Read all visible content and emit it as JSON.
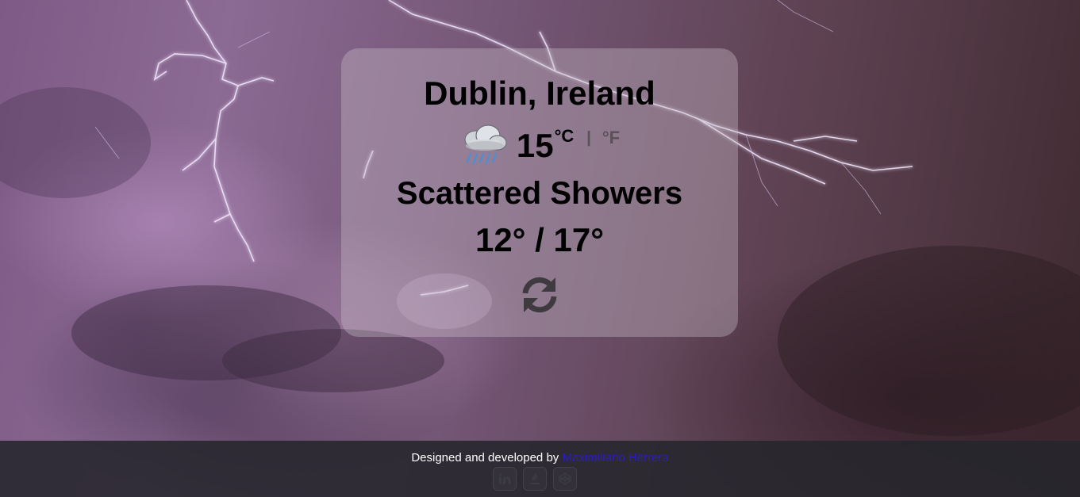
{
  "location": {
    "city": "Dublin, Ireland"
  },
  "current": {
    "temperature": "15",
    "icon": "rain-cloud-icon",
    "unit_celsius": "°C",
    "unit_separator": "|",
    "unit_fahrenheit": "°F",
    "description": "Scattered Showers",
    "range": "12° / 17°"
  },
  "actions": {
    "refresh_icon": "refresh-icon"
  },
  "footer": {
    "text": "Designed and developed by ",
    "author": "Maximiliano Herrera",
    "social": [
      "linkedin-icon",
      "freecodecamp-icon",
      "codepen-icon"
    ]
  },
  "colors": {
    "card_background": "rgba(200,190,200,0.38)",
    "footer_background": "#26262c",
    "link": "#2a1cc4",
    "inactive_unit": "#5a5058"
  }
}
